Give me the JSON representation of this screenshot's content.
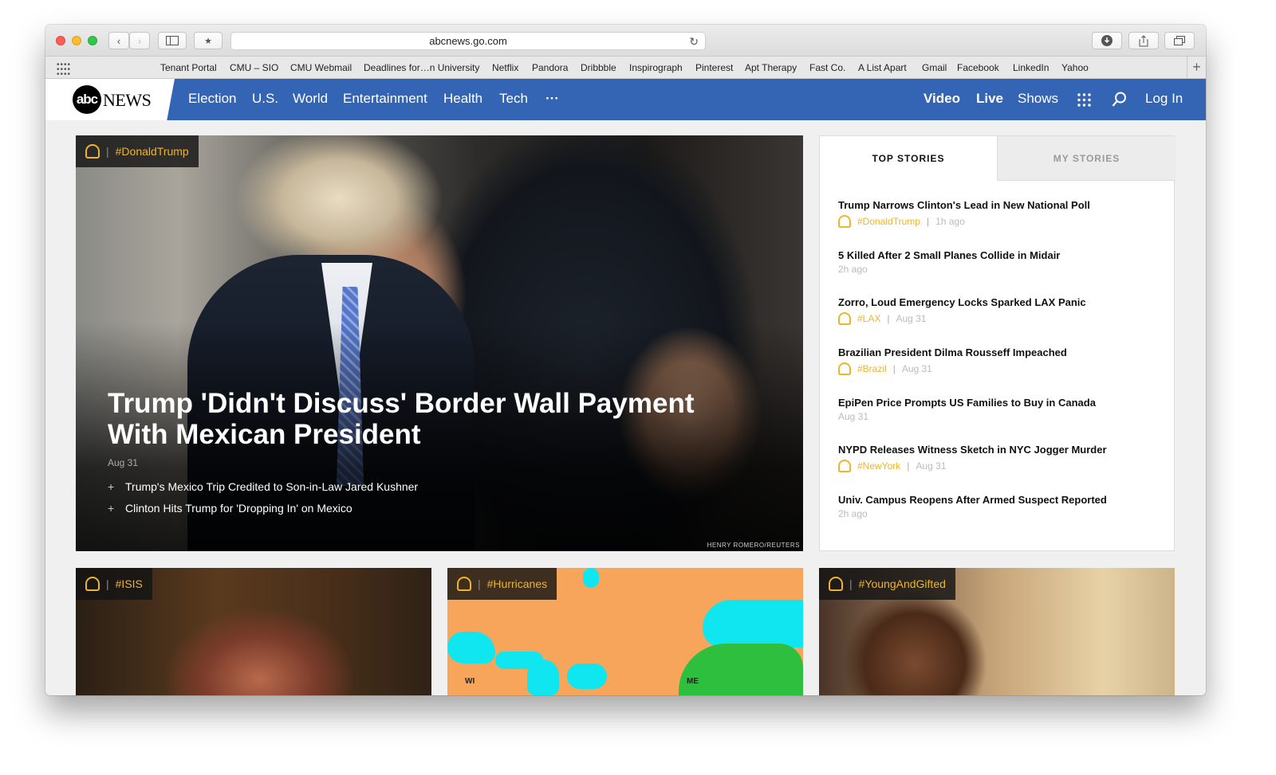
{
  "browser": {
    "url": "abcnews.go.com",
    "bookmarks": [
      "Tenant Portal",
      "CMU – SIO",
      "CMU Webmail",
      "Deadlines for…n University",
      "Netflix",
      "Pandora",
      "Dribbble",
      "Inspirograph",
      "Pinterest",
      "Apt Therapy",
      "Fast Co.",
      "A List Apart",
      "Gmail",
      "Facebook",
      "LinkedIn",
      "Yahoo"
    ]
  },
  "nav": {
    "logo_mark": "abc",
    "logo_text": "NEWS",
    "links": [
      "Election",
      "U.S.",
      "World",
      "Entertainment",
      "Health",
      "Tech"
    ],
    "more": "···",
    "right_links": [
      "Video",
      "Live",
      "Shows"
    ],
    "login": "Log In"
  },
  "hero": {
    "tag": "#DonaldTrump",
    "title": "Trump 'Didn't Discuss' Border Wall Payment With Mexican President",
    "date": "Aug 31",
    "related": [
      "Trump's Mexico Trip Credited to Son-in-Law Jared Kushner",
      "Clinton Hits Trump for 'Dropping In' on Mexico"
    ],
    "credit": "HENRY ROMERO/REUTERS"
  },
  "sidebar": {
    "tabs": [
      "TOP STORIES",
      "MY STORIES"
    ],
    "stories": [
      {
        "title": "Trump Narrows Clinton's Lead in New National Poll",
        "tag": "#DonaldTrump",
        "time": "1h ago"
      },
      {
        "title": "5 Killed After 2 Small Planes Collide in Midair",
        "tag": "",
        "time": "2h ago"
      },
      {
        "title": "Zorro, Loud Emergency Locks Sparked LAX Panic",
        "tag": "#LAX",
        "time": "Aug 31"
      },
      {
        "title": "Brazilian President Dilma Rousseff Impeached",
        "tag": "#Brazil",
        "time": "Aug 31"
      },
      {
        "title": "EpiPen Price Prompts US Families to Buy in Canada",
        "tag": "",
        "time": "Aug 31"
      },
      {
        "title": "NYPD Releases Witness Sketch in NYC Jogger Murder",
        "tag": "#NewYork",
        "time": "Aug 31"
      },
      {
        "title": "Univ. Campus Reopens After Armed Suspect Reported",
        "tag": "",
        "time": "2h ago"
      }
    ]
  },
  "tiles": [
    {
      "tag": "#ISIS"
    },
    {
      "tag": "#Hurricanes",
      "map_labels": [
        "WI",
        "ME"
      ]
    },
    {
      "tag": "#YoungAndGifted"
    }
  ],
  "colors": {
    "nav_blue": "#3465b4",
    "tag_gold": "#f0b428"
  }
}
